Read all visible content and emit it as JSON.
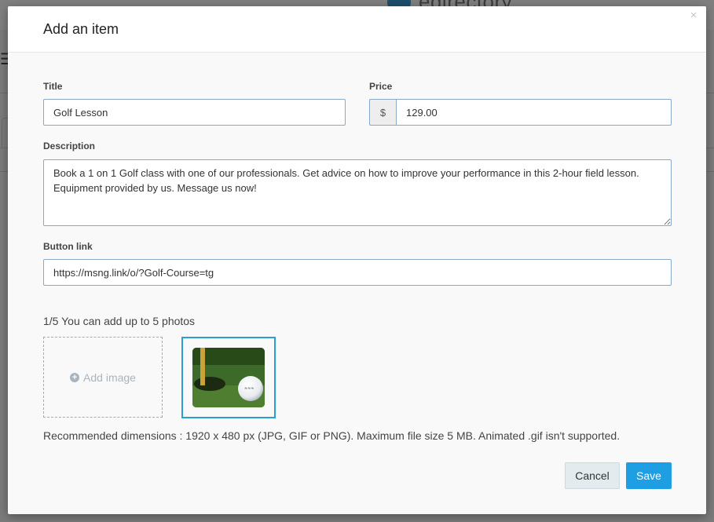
{
  "background": {
    "logo_text": "edirectory",
    "menu_icon": "hamburger-icon"
  },
  "modal": {
    "title": "Add an item",
    "close_icon": "close-icon",
    "close_glyph": "×"
  },
  "form": {
    "title_label": "Title",
    "title_value": "Golf Lesson",
    "price_label": "Price",
    "currency_symbol": "$",
    "price_value": "129.00",
    "description_label": "Description",
    "description_value": "Book a 1 on 1 Golf class with one of our professionals. Get advice on how to improve your performance in this 2-hour field lesson. Equipment provided by us. Message us now!",
    "button_link_label": "Button link",
    "button_link_value": "https://msng.link/o/?Golf-Course=tg"
  },
  "photos": {
    "count_text": "1/5 You can add up to 5 photos",
    "add_image_label": "Add image",
    "add_icon": "plus-circle-icon",
    "recommendation": "Recommended dimensions : 1920 x 480 px (JPG, GIF or PNG). Maximum file size 5 MB. Animated .gif isn't supported."
  },
  "actions": {
    "cancel_label": "Cancel",
    "save_label": "Save"
  },
  "colors": {
    "accent": "#1e9fe3",
    "thumb_border": "#2a9fd0",
    "input_border": "#8aa8c8"
  }
}
